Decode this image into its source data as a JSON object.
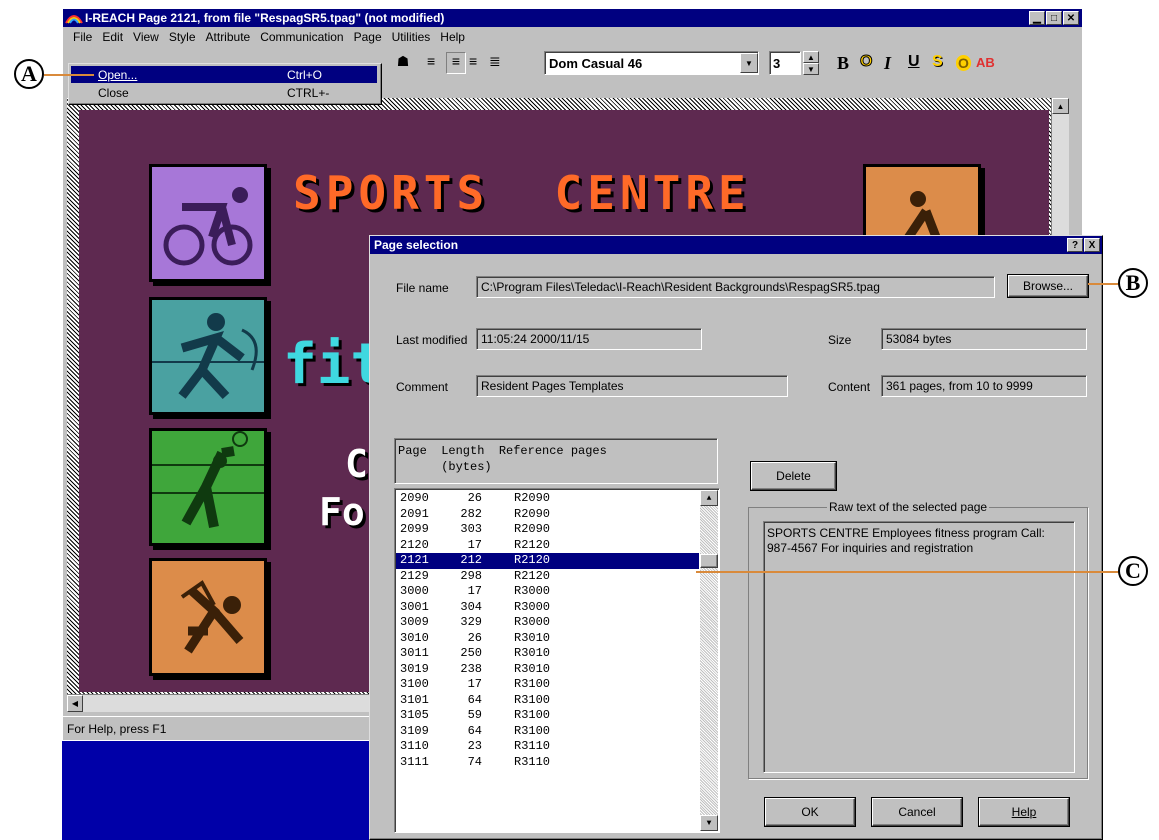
{
  "main_window": {
    "title": "I-REACH  Page 2121,  from file \"RespagSR5.tpag\"  (not modified)",
    "menu": [
      "File",
      "Edit",
      "View",
      "Style",
      "Attribute",
      "Communication",
      "Page",
      "Utilities",
      "Help"
    ],
    "status": "For Help, press F1",
    "font_name": "Dom Casual 46",
    "font_size": "3",
    "format_buttons": [
      "B",
      "O",
      "I",
      "U",
      "S",
      "O",
      "AB"
    ]
  },
  "file_menu": {
    "items": [
      {
        "label": "Open...",
        "shortcut": "Ctrl+O"
      },
      {
        "label": "Close",
        "shortcut": "CTRL+-"
      }
    ]
  },
  "canvas": {
    "headline": "SPORTS  CENTRE",
    "text_fragment": "fit",
    "text_c": "C",
    "text_fo": "Fo"
  },
  "dialog": {
    "title": "Page selection",
    "title_buttons": [
      "?",
      "X"
    ],
    "file_name_label": "File name",
    "file_name_value": "C:\\Program Files\\Teledac\\I-Reach\\Resident Backgrounds\\RespagSR5.tpag",
    "browse_label": "Browse...",
    "last_modified_label": "Last modified",
    "last_modified_value": "11:05:24  2000/11/15",
    "size_label": "Size",
    "size_value": "53084 bytes",
    "comment_label": "Comment",
    "comment_value": "Resident Pages Templates",
    "content_label": "Content",
    "content_value": "361 pages, from 10 to 9999",
    "list_header_line1": "Page  Length  Reference pages",
    "list_header_line2": "      (bytes)",
    "rows": [
      {
        "page": "2090",
        "length": "26",
        "ref": "R2090"
      },
      {
        "page": "2091",
        "length": "282",
        "ref": "R2090"
      },
      {
        "page": "2099",
        "length": "303",
        "ref": "R2090"
      },
      {
        "page": "2120",
        "length": "17",
        "ref": "R2120"
      },
      {
        "page": "2121",
        "length": "212",
        "ref": "R2120",
        "selected": true
      },
      {
        "page": "2129",
        "length": "298",
        "ref": "R2120"
      },
      {
        "page": "3000",
        "length": "17",
        "ref": "R3000"
      },
      {
        "page": "3001",
        "length": "304",
        "ref": "R3000"
      },
      {
        "page": "3009",
        "length": "329",
        "ref": "R3000"
      },
      {
        "page": "3010",
        "length": "26",
        "ref": "R3010"
      },
      {
        "page": "3011",
        "length": "250",
        "ref": "R3010"
      },
      {
        "page": "3019",
        "length": "238",
        "ref": "R3010"
      },
      {
        "page": "3100",
        "length": "17",
        "ref": "R3100"
      },
      {
        "page": "3101",
        "length": "64",
        "ref": "R3100"
      },
      {
        "page": "3105",
        "length": "59",
        "ref": "R3100"
      },
      {
        "page": "3109",
        "length": "64",
        "ref": "R3100"
      },
      {
        "page": "3110",
        "length": "23",
        "ref": "R3110"
      },
      {
        "page": "3111",
        "length": "74",
        "ref": "R3110"
      }
    ],
    "delete_label": "Delete",
    "raw_text_label": "Raw text of the selected page",
    "raw_text_value": "SPORTS  CENTRE Employees fitness program Call: 987-4567  For inquiries and registration",
    "ok_label": "OK",
    "cancel_label": "Cancel",
    "help_label": "Help"
  },
  "callouts": [
    "A",
    "B",
    "C"
  ],
  "colors": {
    "title_blue": "#000080",
    "desktop_blue": "#0000a8",
    "canvas_purple": "#5e2950",
    "headline_orange": "#ff6a28",
    "callout_line": "#d98a3b"
  }
}
